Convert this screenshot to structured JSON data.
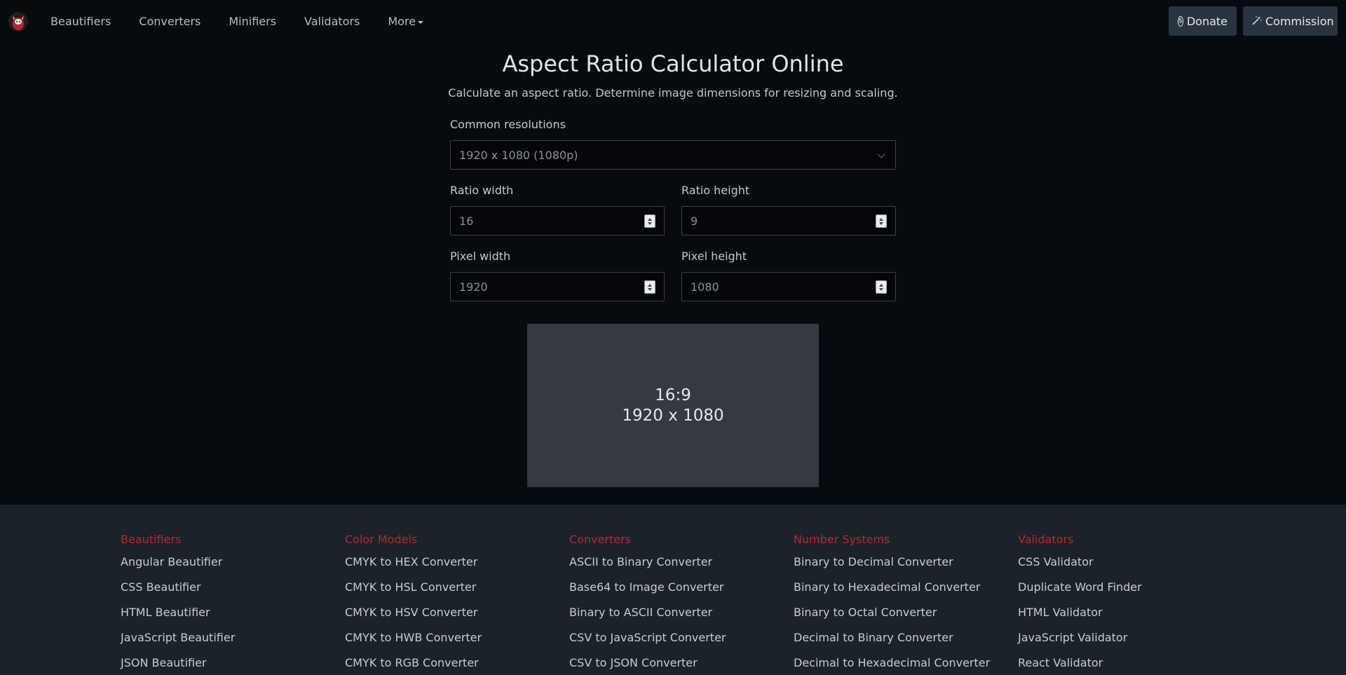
{
  "nav": {
    "items": [
      "Beautifiers",
      "Converters",
      "Minifiers",
      "Validators",
      "More"
    ],
    "donate_label": "Donate",
    "commission_label": "Commission"
  },
  "main": {
    "title": "Aspect Ratio Calculator Online",
    "subtitle": "Calculate an aspect ratio. Determine image dimensions for resizing and scaling.",
    "common_resolutions_label": "Common resolutions",
    "common_resolutions_value": "1920 x 1080 (1080p)",
    "ratio_width_label": "Ratio width",
    "ratio_width_value": "16",
    "ratio_height_label": "Ratio height",
    "ratio_height_value": "9",
    "pixel_width_label": "Pixel width",
    "pixel_width_value": "1920",
    "pixel_height_label": "Pixel height",
    "pixel_height_value": "1080",
    "preview_ratio": "16:9",
    "preview_dims": "1920 x 1080"
  },
  "footer": {
    "columns": [
      {
        "heading": "Beautifiers",
        "links": [
          "Angular Beautifier",
          "CSS Beautifier",
          "HTML Beautifier",
          "JavaScript Beautifier",
          "JSON Beautifier"
        ]
      },
      {
        "heading": "Color Models",
        "links": [
          "CMYK to HEX Converter",
          "CMYK to HSL Converter",
          "CMYK to HSV Converter",
          "CMYK to HWB Converter",
          "CMYK to RGB Converter"
        ]
      },
      {
        "heading": "Converters",
        "links": [
          "ASCII to Binary Converter",
          "Base64 to Image Converter",
          "Binary to ASCII Converter",
          "CSV to JavaScript Converter",
          "CSV to JSON Converter"
        ]
      },
      {
        "heading": "Number Systems",
        "links": [
          "Binary to Decimal Converter",
          "Binary to Hexadecimal Converter",
          "Binary to Octal Converter",
          "Decimal to Binary Converter",
          "Decimal to Hexadecimal Converter"
        ]
      },
      {
        "heading": "Validators",
        "links": [
          "CSS Validator",
          "Duplicate Word Finder",
          "HTML Validator",
          "JavaScript Validator",
          "React Validator"
        ]
      }
    ]
  },
  "colors": {
    "background": "#070a0f",
    "footer_background": "#1b2229",
    "footer_heading": "#b8282c",
    "button_background": "#2a3440",
    "preview_background": "#343a40"
  }
}
